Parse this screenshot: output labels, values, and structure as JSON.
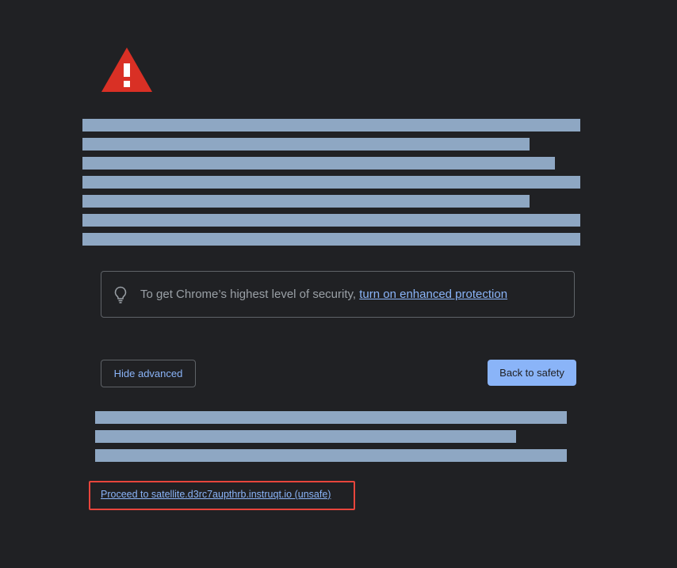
{
  "page": {
    "icon": "warning-triangle-icon",
    "colors": {
      "background": "#202124",
      "warning_red": "#d93025",
      "link_blue": "#8ab4f8",
      "redaction_fill": "#8ea7c3",
      "highlight_border": "#e8453c"
    }
  },
  "tip": {
    "icon": "lightbulb-icon",
    "text": "To get Chrome’s highest level of security, ",
    "link_text": "turn on enhanced protection"
  },
  "buttons": {
    "hide_advanced": "Hide advanced",
    "back_to_safety": "Back to safety"
  },
  "proceed": {
    "link_text": "Proceed to satellite.d3rc7aupthrb.instruqt.io (unsafe)"
  }
}
